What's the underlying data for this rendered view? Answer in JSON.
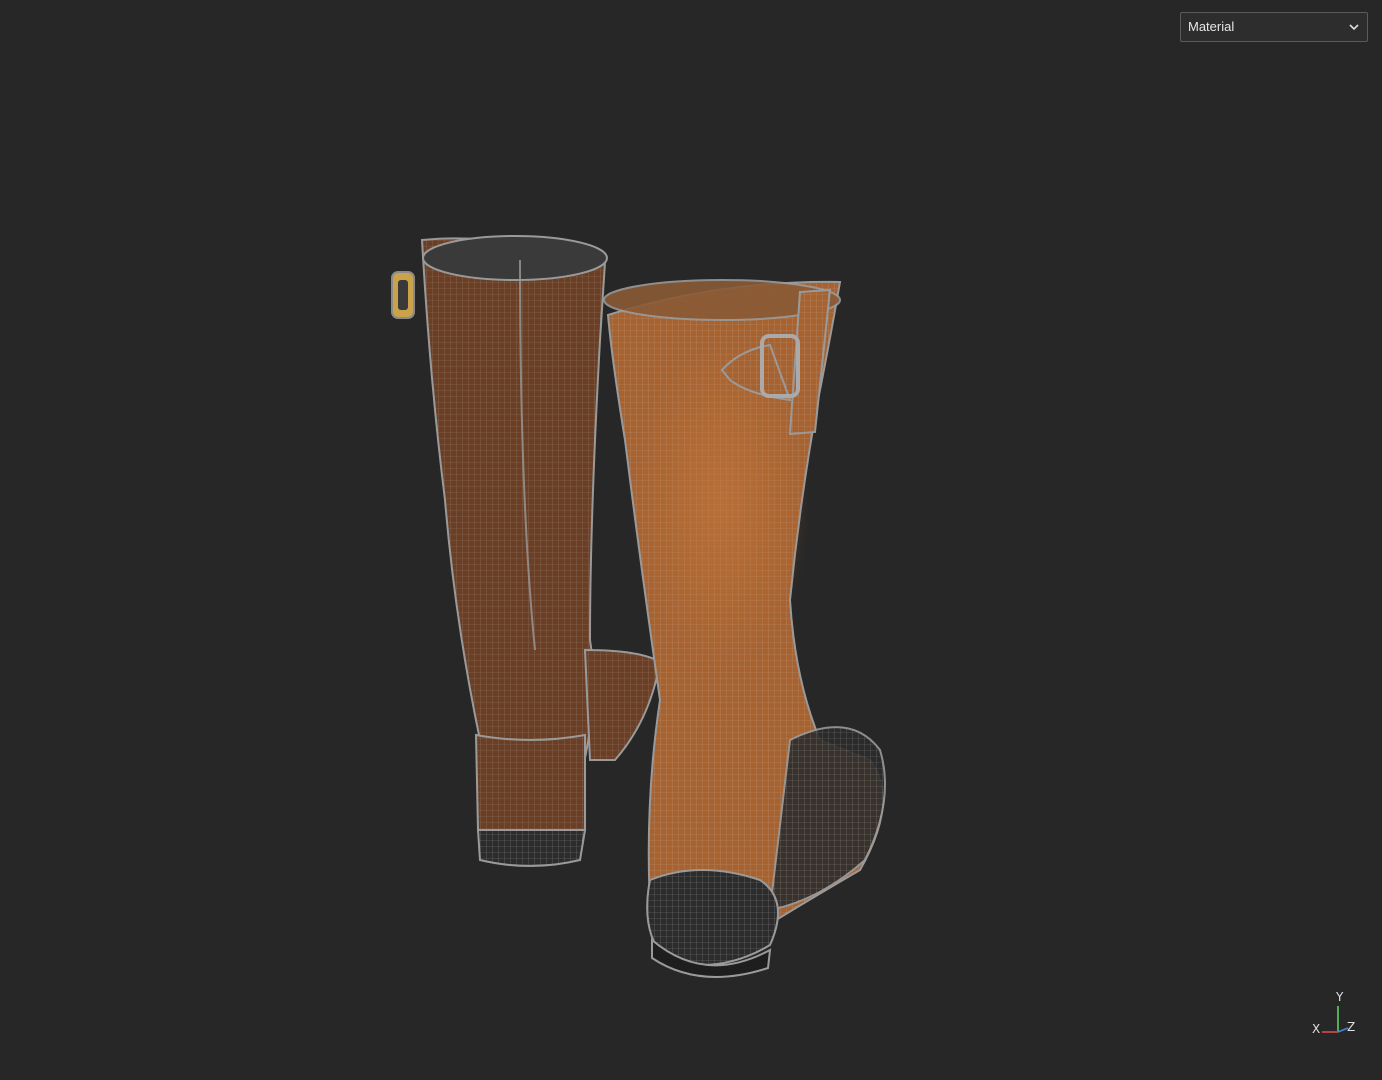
{
  "viewport": {
    "shading_mode": {
      "selected": "Material",
      "icon": "chevron-down-icon"
    },
    "model": {
      "description_icon": "wireframe-boots-model",
      "colors": {
        "background": "#272727",
        "leather_dark": "#6b3f26",
        "leather_light": "#b46a35",
        "wire": "#9a9a9a",
        "sole": "#2a2a2a",
        "buckle": "#c9a24a"
      }
    },
    "axis_gizmo": {
      "x_label": "X",
      "y_label": "Y",
      "z_label": "Z",
      "colors": {
        "x": "#d94c4c",
        "y": "#5fcf5f",
        "z": "#4c7fe0"
      }
    }
  }
}
